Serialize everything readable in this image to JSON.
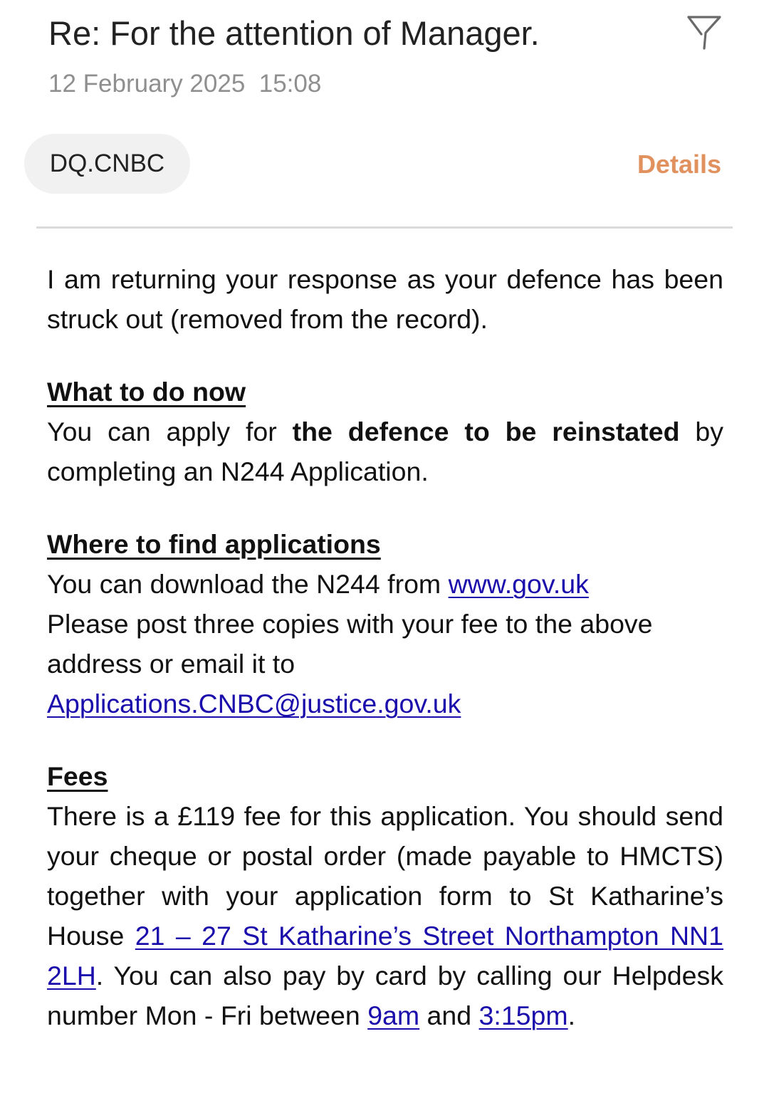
{
  "email": {
    "subject": "Re: For the attention of Manager.",
    "date": "12 February 2025",
    "time": "15:08",
    "sender": "DQ.CNBC",
    "details_label": "Details",
    "flag_icon": "flag-icon"
  },
  "body": {
    "intro": "I am returning your response as your defence has been struck out (removed from the record).",
    "what_heading": "What to do now",
    "what_text_1": "You can apply for ",
    "what_text_bold": "the defence to be reinstated",
    "what_text_2": " by completing an N244 Application.",
    "where_heading": "Where to find applications",
    "where_line1": "You can download the N244 from ",
    "where_link": "www.gov.uk",
    "where_line2": "Please post three copies with your fee to the above address or email it to",
    "where_email": "Applications.CNBC@justice.gov.uk",
    "fees_heading": "Fees",
    "fees_text_1": "There is a £119 fee for this application. You should send your cheque or postal order (made payable to HMCTS) together with your application form to St Katharine’s House ",
    "fees_address_link": "21 – 27 St Katharine’s Street Northampton NN1 2LH",
    "fees_text_2": ". You can also pay by card by calling our Helpdesk number Mon - Fri between ",
    "fees_time_1": "9am",
    "fees_text_3": " and ",
    "fees_time_2": "3:15pm",
    "fees_text_4": "."
  },
  "colors": {
    "accent": "#e0915e",
    "link": "#1a0dab",
    "muted": "#8f8f8f",
    "chip_bg": "#f1f1f1"
  }
}
